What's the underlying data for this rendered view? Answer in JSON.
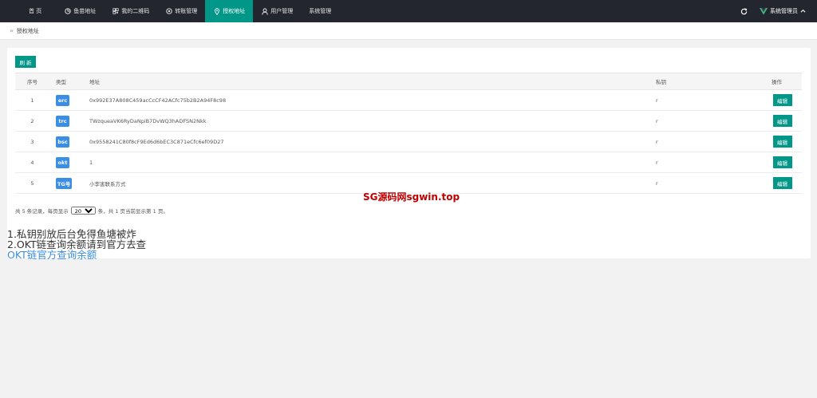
{
  "nav": {
    "items": [
      {
        "label": "首 页",
        "icon": "",
        "active": false
      },
      {
        "label": "鱼苗地址",
        "icon": "fish-icon",
        "active": false
      },
      {
        "label": "我的二维码",
        "icon": "qrcode-icon",
        "active": false
      },
      {
        "label": "转账管理",
        "icon": "transfer-icon",
        "active": false
      },
      {
        "label": "授权地址",
        "icon": "location-icon",
        "active": true
      },
      {
        "label": "用户管理",
        "icon": "user-icon",
        "active": false
      },
      {
        "label": "系统管理",
        "icon": "",
        "active": false
      }
    ],
    "admin_label": "系统管理员"
  },
  "breadcrumb": {
    "text": "授权地址"
  },
  "toolbar": {
    "refresh_label": "刷 新"
  },
  "table": {
    "headers": {
      "no": "序号",
      "type": "类型",
      "address": "地址",
      "key": "私钥",
      "op": "操作"
    },
    "rows": [
      {
        "no": "1",
        "type": "erc",
        "address": "0x992E37A808C459acCcCF42ACfc75b2B2A94F8c98",
        "key": "r",
        "op": "编辑"
      },
      {
        "no": "2",
        "type": "trc",
        "address": "TWzqueaVK6RyDaNpiB7DvWQ3hADFSN2Nkk",
        "key": "r",
        "op": "编辑"
      },
      {
        "no": "3",
        "type": "bsc",
        "address": "0x9558241C80f8cF9Ed6d6bEC3C871eCfc6ef09D27",
        "key": "r",
        "op": "编辑"
      },
      {
        "no": "4",
        "type": "okt",
        "address": "1",
        "key": "r",
        "op": "编辑"
      },
      {
        "no": "5",
        "type": "TG号",
        "address": "小李害联系方式",
        "key": "r",
        "op": "编辑"
      }
    ]
  },
  "pager": {
    "prefix": "共 5 条记录，每页显示",
    "page_size": "20",
    "suffix": "条，共 1 页当前显示第 1 页。"
  },
  "watermark": "SG源码网sgwin.top",
  "notes": {
    "line1": "1.私钥别放后台免得鱼塘被炸",
    "line2": "2.OKT链查询余额请到官方去查",
    "link": "OKT链官方查询余额"
  },
  "colors": {
    "nav_bg": "#23262e",
    "accent": "#009688",
    "badge": "#3a8ee6",
    "link": "#3a8ee6",
    "watermark": "#c00000"
  }
}
